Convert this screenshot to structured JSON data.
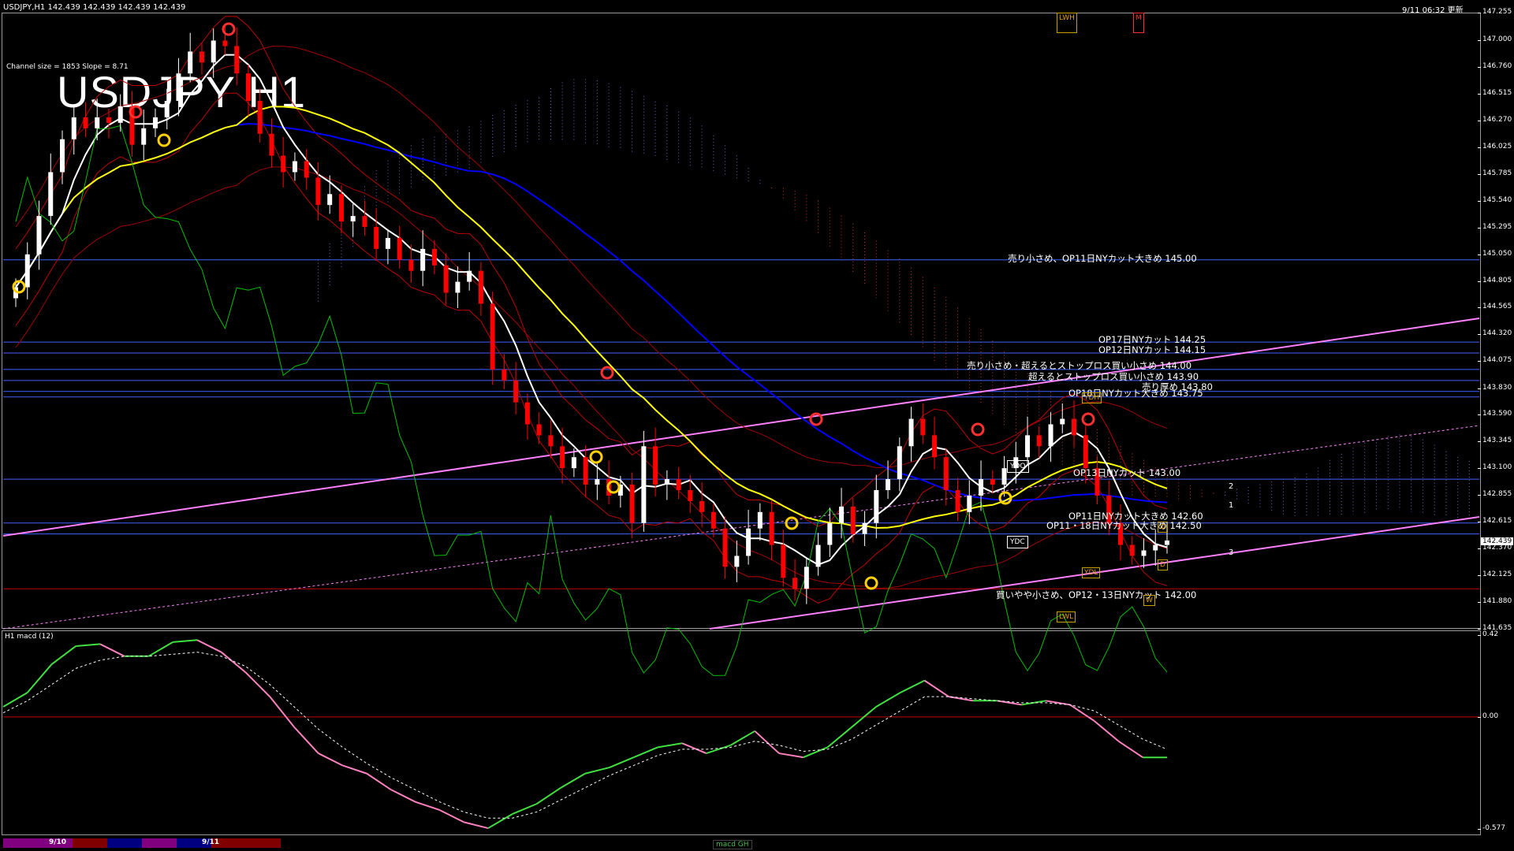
{
  "header": {
    "symbol_ohlc": "USDJPY,H1  142.439 142.439 142.439 142.439",
    "datetime": "9/11 06:32 更新",
    "channel_info": "Channel size = 1853 Slope = 8.71",
    "big_title": "USDJPY H1",
    "macd_label": "H1  macd (12)",
    "macd_tab": "macd GH"
  },
  "price_axis": [
    "147.255",
    "147.000",
    "146.760",
    "146.515",
    "146.270",
    "146.025",
    "145.785",
    "145.540",
    "145.295",
    "145.050",
    "144.805",
    "144.565",
    "144.320",
    "144.075",
    "143.830",
    "143.590",
    "143.345",
    "143.100",
    "142.855",
    "142.615",
    "142.370",
    "142.125",
    "141.880",
    "141.635"
  ],
  "current_price": "142.439",
  "macd_axis": [
    "0.42",
    "0.00",
    "-0.577"
  ],
  "annotations": [
    {
      "text": "売り小さめ、OP11日NYカット大きめ 145.00"
    },
    {
      "text": "OP17日NYカット 144.25"
    },
    {
      "text": "OP12日NYカット 144.15"
    },
    {
      "text": "売り小さめ・超えるとストップロス買い小さめ 144.00"
    },
    {
      "text": "超えるとストップロス買い小さめ 143.90"
    },
    {
      "text": "売り厚め 143.80"
    },
    {
      "text": "OP18日NYカット大きめ 143.75"
    },
    {
      "text": "OP13日NYカット 143.00"
    },
    {
      "text": "OP11日NYカット大きめ 142.60"
    },
    {
      "text": "OP11・18日NYカット大きめ 142.50"
    },
    {
      "text": "買いやや小さめ、OP12・13日NYカット 142.00"
    }
  ],
  "markers": {
    "ydo": "YDO",
    "ydc": "YDC",
    "ydh": "YDH",
    "ydl": "YDL",
    "lwh": "LWH",
    "lwl": "LWL",
    "m": "M",
    "w": "W",
    "d": "D",
    "n1": "1",
    "n2": "2",
    "n3": "3"
  },
  "sessions": [
    {
      "color": "#800080"
    },
    {
      "color": "#800080"
    },
    {
      "color": "#800000"
    },
    {
      "color": "#000080"
    },
    {
      "color": "#800080"
    },
    {
      "color": "#000080"
    },
    {
      "color": "#800000"
    },
    {
      "color": "#800000"
    }
  ],
  "session_labels": [
    "9/10",
    "9/11"
  ],
  "colors": {
    "bull_candle": "#ffffff",
    "bear_candle": "#ff0000",
    "ma_short": "#ffffff",
    "ma_mid": "#ffff00",
    "ma_long": "#0000ff",
    "bollinger": "#c00000",
    "chikou": "#00c000",
    "channel": "#ff80ff",
    "cloud_up": "#8080ff",
    "cloud_down": "#ff4040",
    "level_line": "#4060ff",
    "macd": "#40e040",
    "macd_down": "#ff80c0"
  },
  "chart_data": {
    "type": "candlestick",
    "title": "USDJPY H1",
    "ylim": [
      141.635,
      147.255
    ],
    "candles_close": [
      144.75,
      145.05,
      145.4,
      145.8,
      146.1,
      146.3,
      146.2,
      146.3,
      146.25,
      146.4,
      146.05,
      146.2,
      146.3,
      146.45,
      146.7,
      146.9,
      146.8,
      147.0,
      146.95,
      146.7,
      146.45,
      146.15,
      145.95,
      145.8,
      145.9,
      145.75,
      145.5,
      145.6,
      145.35,
      145.4,
      145.3,
      145.1,
      145.2,
      145.0,
      144.9,
      145.1,
      144.95,
      144.7,
      144.8,
      144.9,
      144.6,
      144.0,
      143.9,
      143.7,
      143.5,
      143.4,
      143.3,
      143.1,
      143.2,
      142.95,
      143.0,
      142.85,
      142.95,
      142.6,
      143.3,
      142.95,
      143.0,
      142.9,
      142.8,
      142.7,
      142.55,
      142.2,
      142.3,
      142.55,
      142.7,
      142.4,
      142.1,
      142.0,
      142.2,
      142.4,
      142.6,
      142.75,
      142.5,
      142.6,
      142.9,
      143.0,
      143.3,
      143.55,
      143.4,
      143.2,
      142.9,
      142.7,
      142.85,
      143.0,
      142.95,
      143.1,
      143.2,
      143.4,
      143.3,
      143.5,
      143.55,
      143.4,
      143.1,
      142.85,
      142.6,
      142.4,
      142.3,
      142.35,
      142.4,
      142.44
    ],
    "levels": [
      {
        "label": "売り小さめ、OP11日NYカット大きめ",
        "value": 145.0
      },
      {
        "label": "OP17日NYカット",
        "value": 144.25
      },
      {
        "label": "OP12日NYカット",
        "value": 144.15
      },
      {
        "label": "売り小さめ・超えるとストップロス買い小さめ",
        "value": 144.0
      },
      {
        "label": "超えるとストップロス買い小さめ",
        "value": 143.9
      },
      {
        "label": "売り厚め",
        "value": 143.8
      },
      {
        "label": "OP18日NYカット大きめ",
        "value": 143.75
      },
      {
        "label": "OP13日NYカット",
        "value": 143.0
      },
      {
        "label": "OP11日NYカット大きめ",
        "value": 142.6
      },
      {
        "label": "OP11・18日NYカット大きめ",
        "value": 142.5
      },
      {
        "label": "買いやや小さめ、OP12・13日NYカット",
        "value": 142.0
      }
    ],
    "macd_ylim": [
      -0.577,
      0.42
    ],
    "macd_values": [
      0.05,
      0.12,
      0.26,
      0.35,
      0.36,
      0.3,
      0.3,
      0.37,
      0.38,
      0.32,
      0.22,
      0.1,
      -0.05,
      -0.18,
      -0.24,
      -0.28,
      -0.36,
      -0.42,
      -0.46,
      -0.52,
      -0.55,
      -0.48,
      -0.43,
      -0.35,
      -0.28,
      -0.25,
      -0.2,
      -0.15,
      -0.13,
      -0.18,
      -0.14,
      -0.07,
      -0.18,
      -0.2,
      -0.15,
      -0.05,
      0.05,
      0.12,
      0.18,
      0.1,
      0.08,
      0.08,
      0.06,
      0.08,
      0.06,
      -0.02,
      -0.12,
      -0.2,
      -0.2
    ],
    "signal_values": [
      0.02,
      0.08,
      0.16,
      0.24,
      0.28,
      0.3,
      0.3,
      0.31,
      0.32,
      0.3,
      0.25,
      0.16,
      0.05,
      -0.06,
      -0.15,
      -0.23,
      -0.3,
      -0.36,
      -0.42,
      -0.47,
      -0.5,
      -0.5,
      -0.47,
      -0.41,
      -0.35,
      -0.29,
      -0.24,
      -0.19,
      -0.16,
      -0.16,
      -0.15,
      -0.12,
      -0.14,
      -0.17,
      -0.16,
      -0.11,
      -0.04,
      0.03,
      0.1,
      0.1,
      0.09,
      0.08,
      0.07,
      0.07,
      0.06,
      0.03,
      -0.04,
      -0.11,
      -0.16
    ]
  }
}
